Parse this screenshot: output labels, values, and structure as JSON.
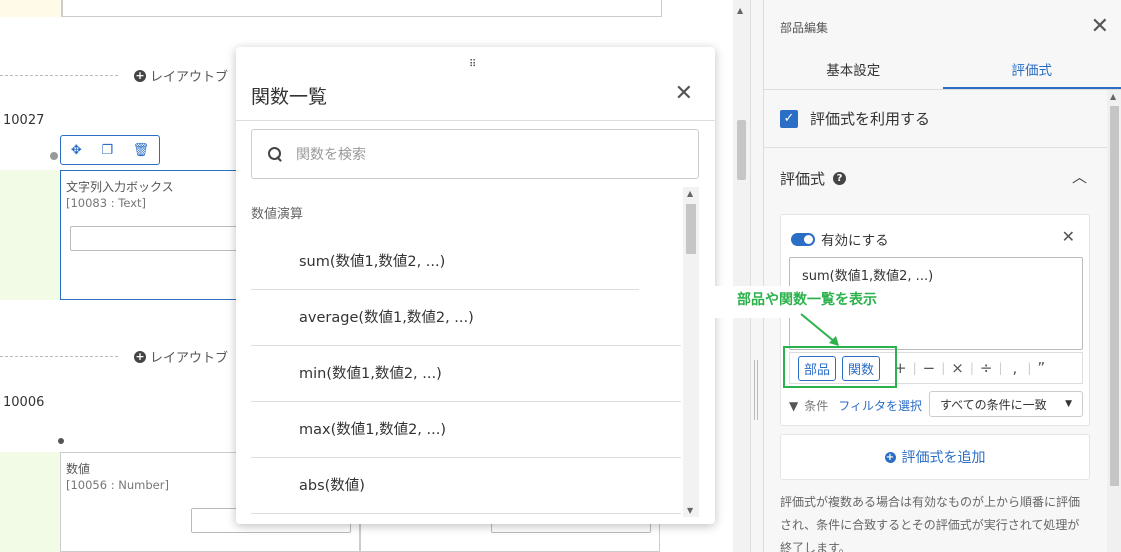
{
  "canvas": {
    "layout_button_label": "レイアウトブ",
    "row1_id": "10027",
    "row2_id": "10006",
    "field1": {
      "title": "文字列入力ボックス",
      "sub": "[10083 : Text]"
    },
    "field2": {
      "title": "数値",
      "sub": "[10056 : Number]"
    },
    "toolbar_icons": [
      "move-icon",
      "copy-icon",
      "trash-icon"
    ]
  },
  "dialog": {
    "title": "関数一覧",
    "search_placeholder": "関数を検索",
    "category": "数値演算",
    "functions": [
      "sum(数値1,数値2, ...)",
      "average(数値1,数値2, ...)",
      "min(数値1,数値2, ...)",
      "max(数値1,数値2, ...)",
      "abs(数値)"
    ]
  },
  "panel": {
    "header": "部品編集",
    "tabs": [
      "基本設定",
      "評価式"
    ],
    "active_tab": 1,
    "use_expression_label": "評価式を利用する",
    "section_title": "評価式",
    "enable_label": "有効にする",
    "expression_text": "sum(数値1,数値2, ...)",
    "chips": [
      "部品",
      "関数"
    ],
    "operators": [
      "+",
      "−",
      "×",
      "÷",
      ",",
      "”"
    ],
    "condition_label": "条件",
    "filter_link": "フィルタを選択",
    "condition_select": "すべての条件に一致",
    "add_button": "評価式を追加",
    "help_text": "評価式が複数ある場合は有効なものが上から順番に評価され、条件に合致するとその評価式が実行されて処理が終了します。",
    "help_lines": [
      "評価式が複数ある場合は有効なものが上から順番に評価",
      "され、条件に合致するとその評価式が実行されて処理が",
      "終了します。"
    ]
  },
  "annotation": {
    "text": "部品や関数一覧を表示",
    "color": "#2bb24c"
  },
  "colors": {
    "accent": "#2b6ec6",
    "annotation": "#2bb24c"
  }
}
